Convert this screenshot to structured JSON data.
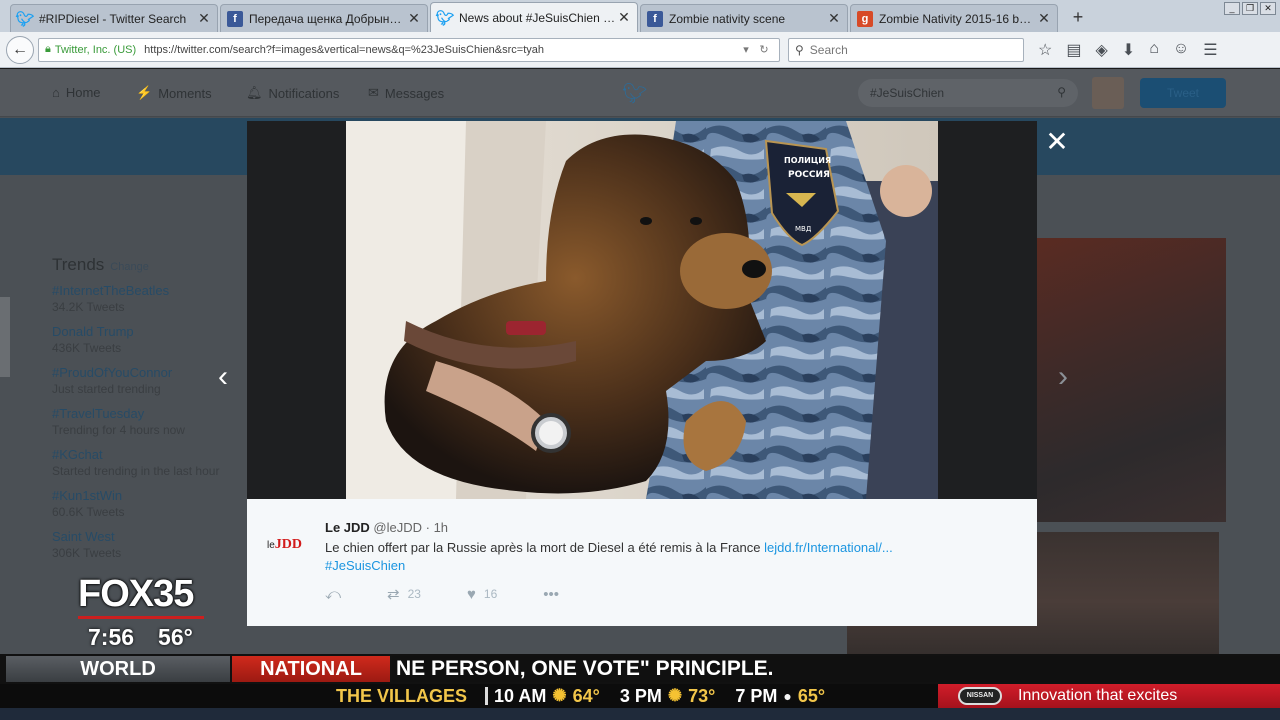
{
  "browser": {
    "tabs": [
      {
        "icon": "twitter",
        "label": "#RIPDiesel - Twitter Search"
      },
      {
        "icon": "facebook",
        "label": "Передача щенка Добрыни ..."
      },
      {
        "icon": "twitter",
        "label": "News about #JeSuisChien on ..."
      },
      {
        "icon": "facebook",
        "label": "Zombie nativity scene"
      },
      {
        "icon": "g",
        "label": "Zombie Nativity 2015-16 by A..."
      }
    ],
    "identity": "Twitter, Inc. (US)",
    "url": "https://twitter.com/search?f=images&vertical=news&q=%23JeSuisChien&src=tyah",
    "search_placeholder": "Search"
  },
  "twitter": {
    "nav": [
      "Home",
      "Moments",
      "Notifications",
      "Messages"
    ],
    "search_value": "#JeSuisChien",
    "tweet_button": "Tweet",
    "trends_title": "Trends",
    "trends_change": "Change",
    "trends": [
      {
        "name": "#InternetTheBeatles",
        "count": "34.2K Tweets"
      },
      {
        "name": "Donald Trump",
        "count": "436K Tweets"
      },
      {
        "name": "#ProudOfYouConnor",
        "count": "Just started trending"
      },
      {
        "name": "#TravelTuesday",
        "count": "Trending for 4 hours now"
      },
      {
        "name": "#KGchat",
        "count": "Started trending in the last hour"
      },
      {
        "name": "#Kun1stWin",
        "count": "60.6K Tweets"
      },
      {
        "name": "Saint West",
        "count": "306K Tweets"
      }
    ]
  },
  "tweet": {
    "avatar_le": "le",
    "avatar_jdd": "JDD",
    "name": "Le JDD",
    "handle": "@leJDD",
    "time": "· 1h",
    "text": "Le chien offert par la Russie après la mort de Diesel a été remis à la France",
    "link": "lejdd.fr/International/...",
    "hashtag": "#JeSuisChien",
    "retweets": "23",
    "likes": "16",
    "photo_patch_lines": [
      "ПОЛИЦИЯ",
      "РОССИЯ",
      "МВД"
    ]
  },
  "tv": {
    "logo": "FOX35",
    "time": "7:56",
    "temp": "56°",
    "world": "WORLD",
    "national": "NATIONAL",
    "headline": "NE PERSON, ONE VOTE\" PRINCIPLE.",
    "villages": "THE VILLAGES",
    "forecast": [
      {
        "time": "10 AM",
        "temp": "64°",
        "icon": "sun"
      },
      {
        "time": "3 PM",
        "temp": "73°",
        "icon": "sun"
      },
      {
        "time": "7 PM",
        "temp": "65°",
        "icon": "moon"
      }
    ],
    "ad_brand": "NISSAN",
    "ad_slogan": "Innovation that excites"
  }
}
